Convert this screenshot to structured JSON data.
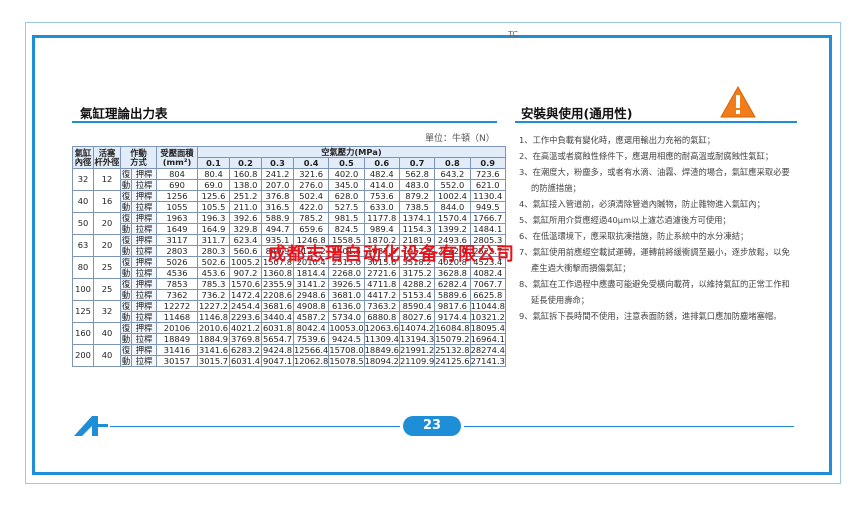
{
  "edge_mark": "TC",
  "left_title": "氣缸理論出力表",
  "right_title": "安裝與使用(通用性)",
  "unit_label": "單位：牛頓（N）",
  "table": {
    "h_bore": "氣缸\n內徑",
    "h_rod": "活塞\n杆外徑",
    "h_action": "作動\n方式",
    "h_area": "受壓面積\n(mm²)",
    "h_pressure": "空氣壓力(MPa)",
    "pressures": [
      "0.1",
      "0.2",
      "0.3",
      "0.4",
      "0.5",
      "0.6",
      "0.7",
      "0.8",
      "0.9"
    ],
    "action_push_a": "復",
    "action_push_b": "押桿",
    "action_pull_a": "動",
    "action_pull_b": "拉桿",
    "rows": [
      {
        "bore": "32",
        "rod": "12",
        "push_area": "804",
        "push": [
          "80.4",
          "160.8",
          "241.2",
          "321.6",
          "402.0",
          "482.4",
          "562.8",
          "643.2",
          "723.6"
        ],
        "pull_area": "690",
        "pull": [
          "69.0",
          "138.0",
          "207.0",
          "276.0",
          "345.0",
          "414.0",
          "483.0",
          "552.0",
          "621.0"
        ]
      },
      {
        "bore": "40",
        "rod": "16",
        "push_area": "1256",
        "push": [
          "125.6",
          "251.2",
          "376.8",
          "502.4",
          "628.0",
          "753.6",
          "879.2",
          "1002.4",
          "1130.4"
        ],
        "pull_area": "1055",
        "pull": [
          "105.5",
          "211.0",
          "316.5",
          "422.0",
          "527.5",
          "633.0",
          "738.5",
          "844.0",
          "949.5"
        ]
      },
      {
        "bore": "50",
        "rod": "20",
        "push_area": "1963",
        "push": [
          "196.3",
          "392.6",
          "588.9",
          "785.2",
          "981.5",
          "1177.8",
          "1374.1",
          "1570.4",
          "1766.7"
        ],
        "pull_area": "1649",
        "pull": [
          "164.9",
          "329.8",
          "494.7",
          "659.6",
          "824.5",
          "989.4",
          "1154.3",
          "1399.2",
          "1484.1"
        ]
      },
      {
        "bore": "63",
        "rod": "20",
        "push_area": "3117",
        "push": [
          "311.7",
          "623.4",
          "935.1",
          "1246.8",
          "1558.5",
          "1870.2",
          "2181.9",
          "2493.6",
          "2805.3"
        ],
        "pull_area": "2803",
        "pull": [
          "280.3",
          "560.6",
          "840.9",
          "1121.2",
          "1401.5",
          "1681.8",
          "1962.1",
          "2242.4",
          "2522.7"
        ]
      },
      {
        "bore": "80",
        "rod": "25",
        "push_area": "5026",
        "push": [
          "502.6",
          "1005.2",
          "1507.8",
          "2010.4",
          "2513.0",
          "3015.6",
          "3518.2",
          "4020.8",
          "4523.4"
        ],
        "pull_area": "4536",
        "pull": [
          "453.6",
          "907.2",
          "1360.8",
          "1814.4",
          "2268.0",
          "2721.6",
          "3175.2",
          "3628.8",
          "4082.4"
        ]
      },
      {
        "bore": "100",
        "rod": "25",
        "push_area": "7853",
        "push": [
          "785.3",
          "1570.6",
          "2355.9",
          "3141.2",
          "3926.5",
          "4711.8",
          "4288.2",
          "6282.4",
          "7067.7"
        ],
        "pull_area": "7362",
        "pull": [
          "736.2",
          "1472.4",
          "2208.6",
          "2948.6",
          "3681.0",
          "4417.2",
          "5153.4",
          "5889.6",
          "6625.8"
        ]
      },
      {
        "bore": "125",
        "rod": "32",
        "push_area": "12272",
        "push": [
          "1227.2",
          "2454.4",
          "3681.6",
          "4908.8",
          "6136.0",
          "7363.2",
          "8590.4",
          "9817.6",
          "11044.8"
        ],
        "pull_area": "11468",
        "pull": [
          "1146.8",
          "2293.6",
          "3440.4",
          "4587.2",
          "5734.0",
          "6880.8",
          "8027.6",
          "9174.4",
          "10321.2"
        ]
      },
      {
        "bore": "160",
        "rod": "40",
        "push_area": "20106",
        "push": [
          "2010.6",
          "4021.2",
          "6031.8",
          "8042.4",
          "10053.0",
          "12063.6",
          "14074.2",
          "16084.8",
          "18095.4"
        ],
        "pull_area": "18849",
        "pull": [
          "1884.9",
          "3769.8",
          "5654.7",
          "7539.6",
          "9424.5",
          "11309.4",
          "13194.3",
          "15079.2",
          "16964.1"
        ]
      },
      {
        "bore": "200",
        "rod": "40",
        "push_area": "31416",
        "push": [
          "3141.6",
          "6283.2",
          "9424.8",
          "12566.4",
          "15708.0",
          "18849.6",
          "21991.2",
          "25132.8",
          "28274.4"
        ],
        "pull_area": "30157",
        "pull": [
          "3015.7",
          "6031.4",
          "9047.1",
          "12062.8",
          "15078.5",
          "18094.2",
          "21109.9",
          "24125.6",
          "27141.3"
        ]
      }
    ]
  },
  "notes": [
    "1、工作中負載有變化時，應選用輸出力充裕的氣缸；",
    "2、在高溫或者腐蝕性條件下，應選用相應的耐高溫或耐腐蝕性氣缸；",
    "3、在潮度大，粉塵多，或者有水滴、油霧、焊渣的場合，氣缸應采取必要的防護措施；",
    "4、氣缸接入管道前，必須清除管道內贓物，防止雜物進入氣缸內；",
    "5、氣缸所用介質應經過40μm以上濾芯過濾後方可使用；",
    "6、在低溫環境下，應采取抗凍措施，防止系統中的水分凍結；",
    "7、氣缸使用前應經空載試運轉，運轉前將緩衝調至最小，逐步放鬆，以免產生過大衝擊而損傷氣缸；",
    "8、氣缸在工作過程中應盡可能避免受橫向載荷，以維持氣缸的正常工作和延長使用壽命；",
    "9、氣缸拆下長時間不使用，注意表面防銹，進排氣口應加防塵堵塞帽。"
  ],
  "watermark": "成都志瑨自动化设备有限公司",
  "page_number": "23",
  "accent_color": "#1e8fd6",
  "warning_color": "#f07d1a",
  "icons": {
    "warning": "warning-triangle-icon",
    "logo": "brand-logo-icon"
  }
}
